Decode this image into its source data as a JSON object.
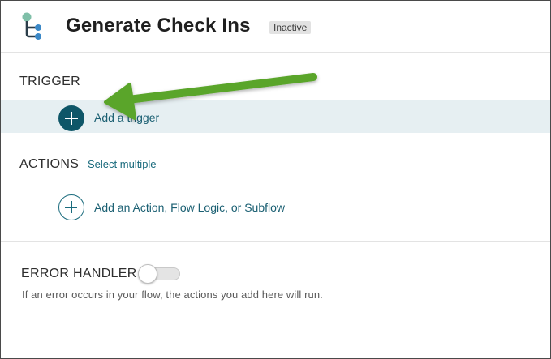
{
  "header": {
    "title": "Generate Check Ins",
    "status": "Inactive",
    "icon": "flow-icon"
  },
  "trigger": {
    "heading": "TRIGGER",
    "add_label": "Add a trigger",
    "add_icon": "plus-circle-icon"
  },
  "actions": {
    "heading": "ACTIONS",
    "select_multiple": "Select multiple",
    "add_label": "Add an Action, Flow Logic, or Subflow",
    "add_icon": "plus-circle-icon"
  },
  "error_handler": {
    "heading": "ERROR HANDLER",
    "enabled": false,
    "help": "If an error occurs in your flow, the actions you add here will run."
  },
  "colors": {
    "accent": "#0e5668",
    "link": "#1a6b7d",
    "highlight_row": "#e6eff2",
    "annotation": "#5aa52a"
  }
}
